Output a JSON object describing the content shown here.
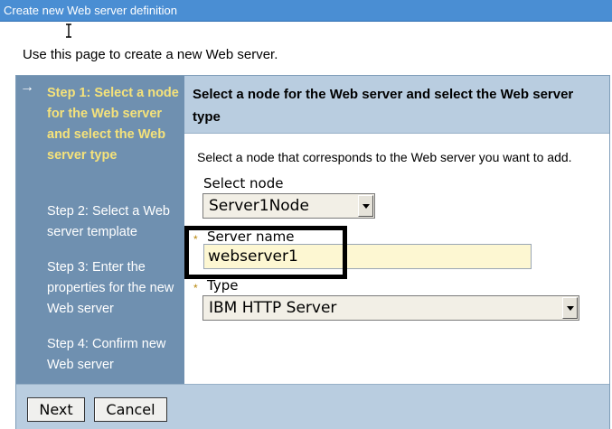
{
  "window": {
    "title": "Create new Web server definition"
  },
  "intro": "Use this page to create a new Web server.",
  "steps": [
    {
      "label": "Step 1: Select a node for the Web server and select the Web server type",
      "current": true
    },
    {
      "label": "Step 2: Select a Web server template",
      "current": false
    },
    {
      "label": "Step 3: Enter the properties for the new Web server",
      "current": false
    },
    {
      "label": "Step 4: Confirm new Web server",
      "current": false
    }
  ],
  "content": {
    "heading": "Select a node for the Web server and select the Web server type",
    "description": "Select a node that corresponds to the Web server you want to add."
  },
  "form": {
    "node": {
      "label": "Select node",
      "value": "Server1Node"
    },
    "server_name": {
      "label": "Server name",
      "value": "webserver1",
      "required": true
    },
    "type": {
      "label": "Type",
      "value": "IBM HTTP Server",
      "required": true
    },
    "required_marker": "*"
  },
  "buttons": {
    "next": "Next",
    "cancel": "Cancel"
  },
  "icons": {
    "current_step": "arrow-right-icon",
    "cursor": "text-cursor-icon"
  },
  "colors": {
    "title_bar": "#4a8ed3",
    "steps_panel": "#6f90b0",
    "current_step_text": "#f5e27a",
    "header_band": "#b9cde0",
    "input_background": "#fdf7d2"
  }
}
